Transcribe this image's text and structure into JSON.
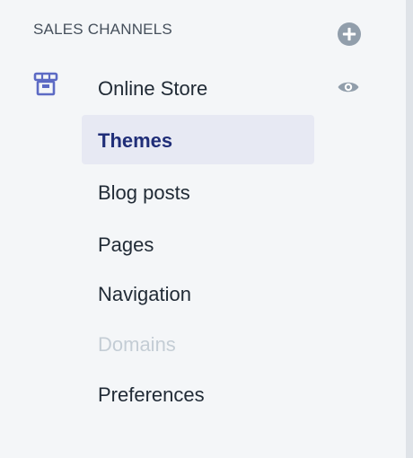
{
  "sales_channels": {
    "header": "SALES CHANNELS",
    "add_icon": "plus-circle-icon",
    "channel": {
      "label": "Online Store",
      "icon": "store-icon",
      "view_icon": "eye-icon"
    },
    "subitems": [
      {
        "label": "Themes",
        "state": "active"
      },
      {
        "label": "Blog posts",
        "state": "normal"
      },
      {
        "label": "Pages",
        "state": "normal"
      },
      {
        "label": "Navigation",
        "state": "normal"
      },
      {
        "label": "Domains",
        "state": "disabled"
      },
      {
        "label": "Preferences",
        "state": "normal"
      }
    ]
  },
  "colors": {
    "background": "#f4f6f8",
    "icon_gray": "#919eab",
    "accent_indigo": "#5c6ac4",
    "active_bg": "#e7e9f3",
    "active_text": "#202e78",
    "disabled_text": "#c4cdd5",
    "text": "#212b36"
  }
}
